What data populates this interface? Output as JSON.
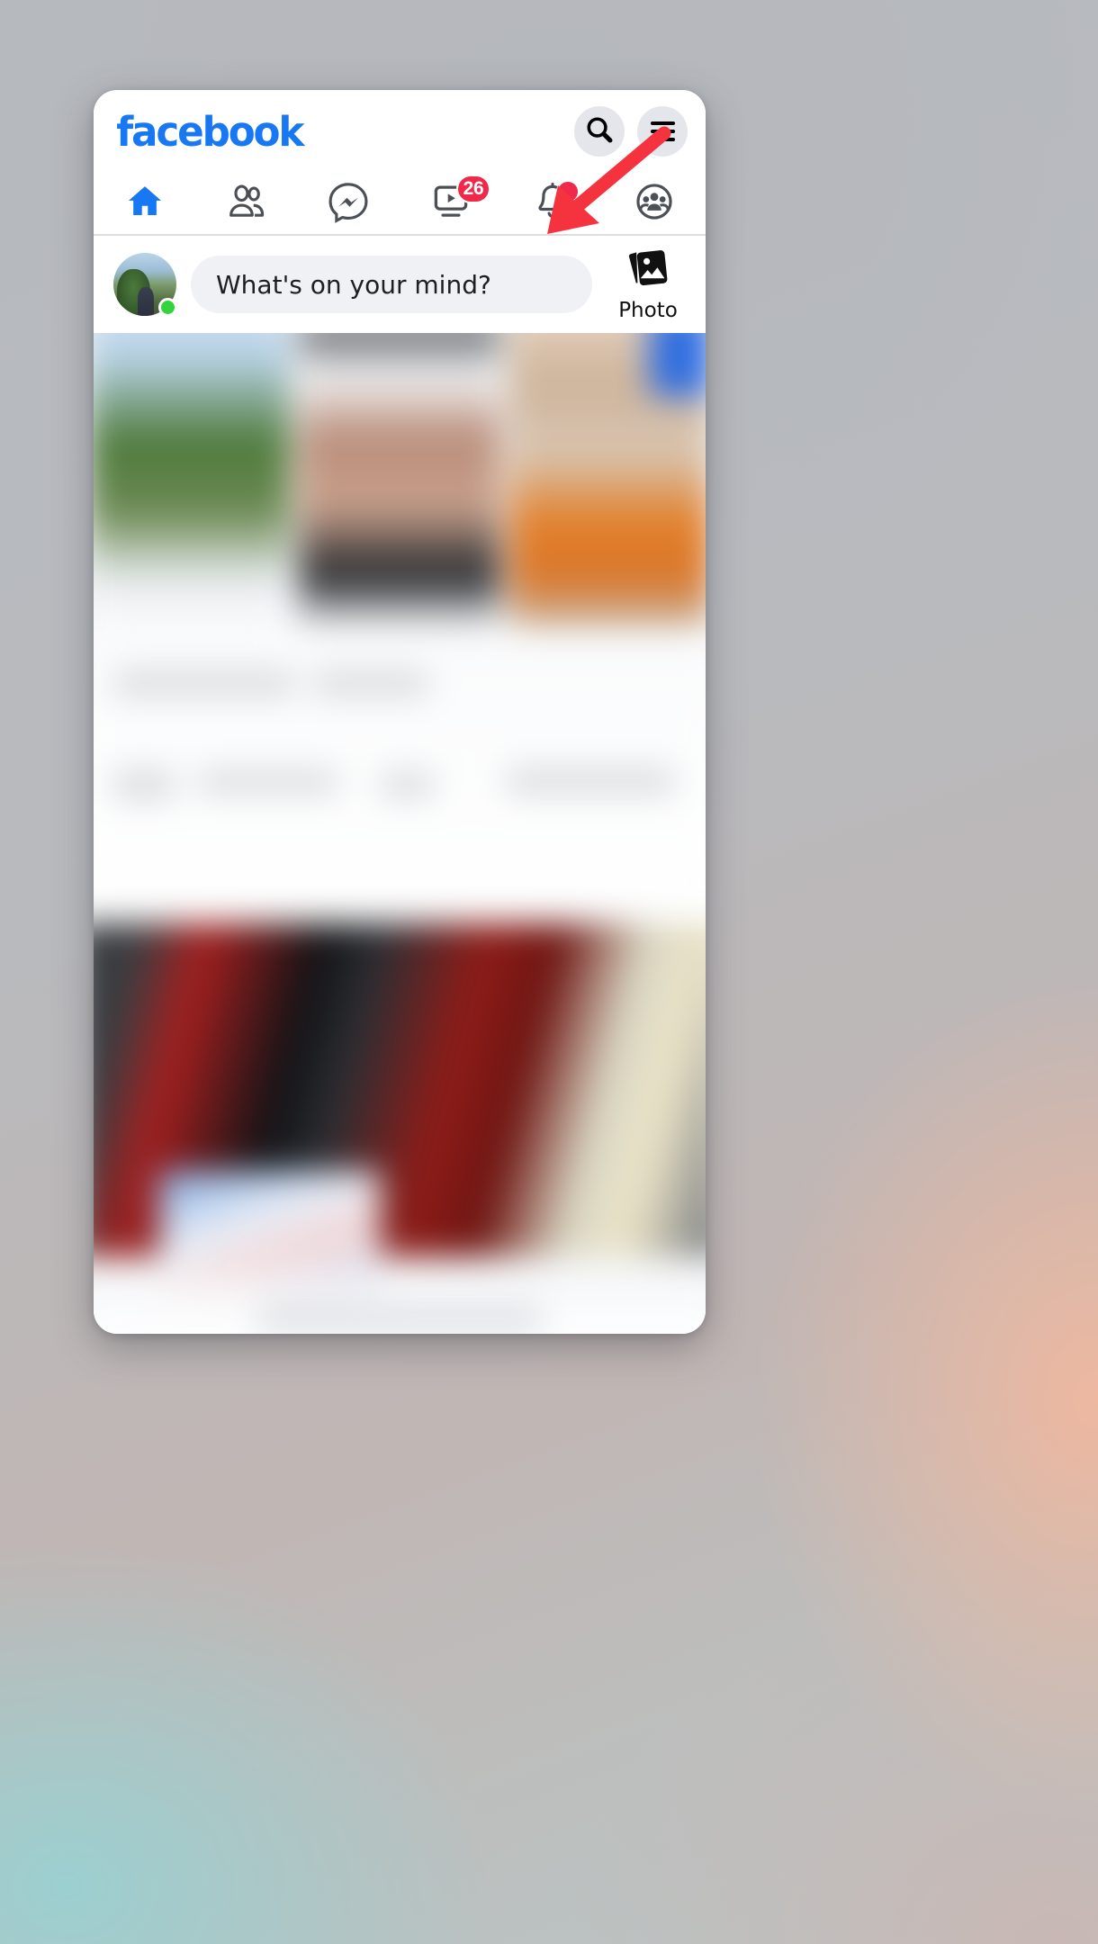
{
  "background": {
    "description": "blurred desktop wallpaper gradient",
    "colors": {
      "teal": "#9ccfd0",
      "peach": "#eeb8a0",
      "grey": "#b6b9be"
    }
  },
  "annotation": {
    "type": "arrow",
    "color": "#F5333F",
    "points_to": "messenger-tab",
    "direction": "down-left"
  },
  "app": {
    "brand": "facebook",
    "brand_color": "#1877F2",
    "header": {
      "search_icon": "search-icon",
      "menu_icon": "hamburger-menu-icon",
      "button_bg": "#E4E6EB"
    },
    "nav": {
      "active_index": 0,
      "active_color": "#1877F2",
      "inactive_color": "#4b4f56",
      "tabs": [
        {
          "name": "home",
          "icon": "home-icon",
          "active": true,
          "badge": null
        },
        {
          "name": "friends",
          "icon": "friends-icon",
          "active": false,
          "badge": null
        },
        {
          "name": "messenger",
          "icon": "messenger-icon",
          "active": false,
          "badge": null
        },
        {
          "name": "watch",
          "icon": "watch-video-icon",
          "active": false,
          "badge": "26"
        },
        {
          "name": "notifications",
          "icon": "notification-bell-icon",
          "active": false,
          "badge": "dot"
        },
        {
          "name": "groups",
          "icon": "groups-icon",
          "active": false,
          "badge": null
        }
      ],
      "badge_color": "#F02849"
    },
    "composer": {
      "avatar_name": "profile-avatar",
      "online_status": true,
      "online_color": "#31D43B",
      "placeholder": "What's on your mind?",
      "photo_label": "Photo",
      "photo_icon": "photo-stack-icon",
      "input_bg": "#EFF1F5"
    },
    "feed": {
      "blurred": true,
      "stories_count": 3,
      "sections": [
        "stories",
        "post-text",
        "post-photo",
        "post-footer"
      ]
    }
  }
}
